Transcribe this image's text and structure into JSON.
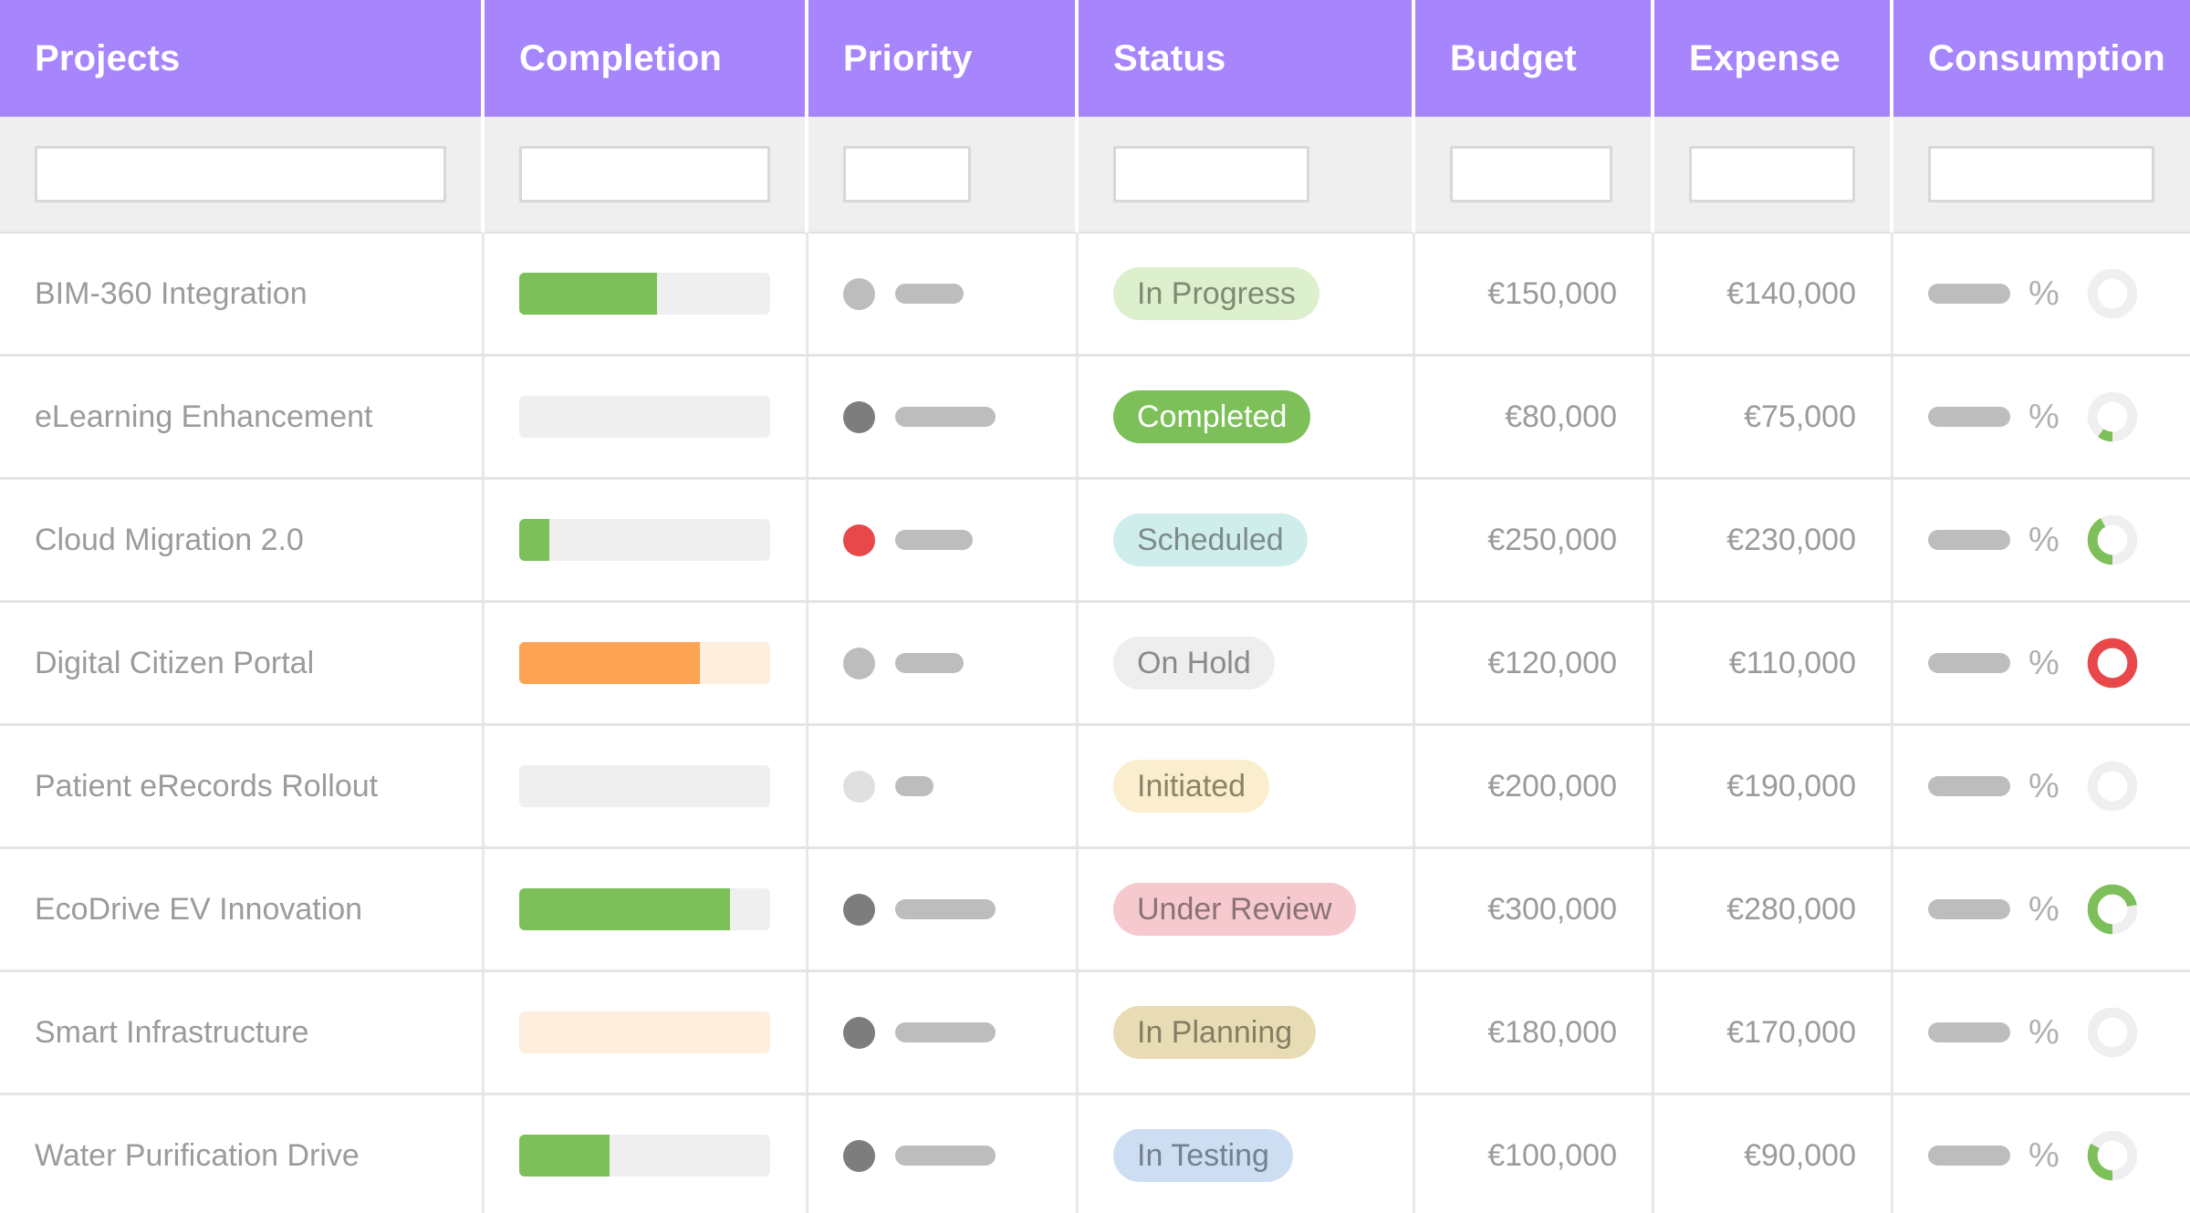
{
  "table": {
    "columns": [
      {
        "key": "projects",
        "label": "Projects",
        "filter_value": "",
        "filter_placeholder": ""
      },
      {
        "key": "completion",
        "label": "Completion",
        "filter_value": "",
        "filter_placeholder": ""
      },
      {
        "key": "priority",
        "label": "Priority",
        "filter_value": "",
        "filter_placeholder": ""
      },
      {
        "key": "status",
        "label": "Status",
        "filter_value": "",
        "filter_placeholder": ""
      },
      {
        "key": "budget",
        "label": "Budget",
        "filter_value": "",
        "filter_placeholder": ""
      },
      {
        "key": "expense",
        "label": "Expense",
        "filter_value": "",
        "filter_placeholder": ""
      },
      {
        "key": "consumption",
        "label": "Consumption",
        "filter_value": "",
        "filter_placeholder": ""
      }
    ],
    "percent_symbol": "%",
    "rows": [
      {
        "project": "BIM-360 Integration",
        "completion_percent": 55,
        "completion_fill_color": "#7dc05a",
        "completion_track_color": "#efefef",
        "priority_dot_color": "#f9a košice",
        "priority_label_width": 75,
        "status": "In Progress",
        "status_bg": "#dcf0cd",
        "status_fg": "#7e8a72",
        "budget": "€150,000",
        "expense": "€140,000",
        "consumption_percent": 0,
        "consumption_ring_color": "#7dc05a"
      },
      {
        "project": "eLearning Enhancement",
        "completion_percent": 0,
        "completion_fill_color": "#7dc05a",
        "completion_track_color": "#efefef",
        "priority_dot_color": "#7d7d7d",
        "priority_label_width": 110,
        "status": "Completed",
        "status_bg": "#7dc05a",
        "status_fg": "#ffffff",
        "budget": "€80,000",
        "expense": "€75,000",
        "consumption_percent": 10,
        "consumption_ring_color": "#7dc05a"
      },
      {
        "project": "Cloud Migration 2.0",
        "completion_percent": 12,
        "completion_fill_color": "#7dc05a",
        "completion_track_color": "#efefef",
        "priority_dot_color": "#e8484a",
        "priority_label_width": 85,
        "status": "Scheduled",
        "status_bg": "#cfeeeb",
        "status_fg": "#7d8c8b",
        "budget": "€250,000",
        "expense": "€230,000",
        "consumption_percent": 42,
        "consumption_ring_color": "#7dc05a"
      },
      {
        "project": "Digital Citizen Portal",
        "completion_percent": 72,
        "completion_fill_color": "#fca354",
        "completion_track_color": "#fdeede",
        "priority_dot_color": "#f9a košice",
        "priority_label_width": 75,
        "status": "On Hold",
        "status_bg": "#eeeeee",
        "status_fg": "#8a8a8a",
        "budget": "€120,000",
        "expense": "€110,000",
        "consumption_percent": 100,
        "consumption_ring_color": "#e8484a"
      },
      {
        "project": "Patient eRecords Rollout",
        "completion_percent": 0,
        "completion_fill_color": "#7dc05a",
        "completion_track_color": "#efefef",
        "priority_dot_color": "#e0e0e0",
        "priority_label_width": 42,
        "status": "Initiated",
        "status_bg": "#faeece",
        "status_fg": "#8c8468",
        "budget": "€200,000",
        "expense": "€190,000",
        "consumption_percent": 0,
        "consumption_ring_color": "#7dc05a"
      },
      {
        "project": "EcoDrive EV Innovation",
        "completion_percent": 84,
        "completion_fill_color": "#7dc05a",
        "completion_track_color": "#efefef",
        "priority_dot_color": "#7d7d7d",
        "priority_label_width": 110,
        "status": "Under Review",
        "status_bg": "#f5c9cd",
        "status_fg": "#8a7276",
        "budget": "€300,000",
        "expense": "€280,000",
        "consumption_percent": 72,
        "consumption_ring_color": "#7dc05a"
      },
      {
        "project": "Smart Infrastructure",
        "completion_percent": 0,
        "completion_fill_color": "#fca354",
        "completion_track_color": "#fdeede",
        "priority_dot_color": "#7d7d7d",
        "priority_label_width": 110,
        "status": "In Planning",
        "status_bg": "#e8dcb5",
        "status_fg": "#867e63",
        "budget": "€180,000",
        "expense": "€170,000",
        "consumption_percent": 0,
        "consumption_ring_color": "#7dc05a"
      },
      {
        "project": "Water Purification Drive",
        "completion_percent": 36,
        "completion_fill_color": "#7dc05a",
        "completion_track_color": "#efefef",
        "priority_dot_color": "#7d7d7d",
        "priority_label_width": 110,
        "status": "In Testing",
        "status_bg": "#cedef2",
        "status_fg": "#73808f",
        "budget": "€100,000",
        "expense": "€90,000",
        "consumption_percent": 33,
        "consumption_ring_color": "#7dc05a"
      }
    ]
  },
  "theme": {
    "header_bg": "#a685fd",
    "header_fg": "#ffffff",
    "filter_bg": "#efefef",
    "text_muted": "#9b9b9b",
    "green": "#7dc05a",
    "orange": "#fca354",
    "red": "#e8484a",
    "gray": "#7d7d7d",
    "ring_track": "#efefef"
  }
}
